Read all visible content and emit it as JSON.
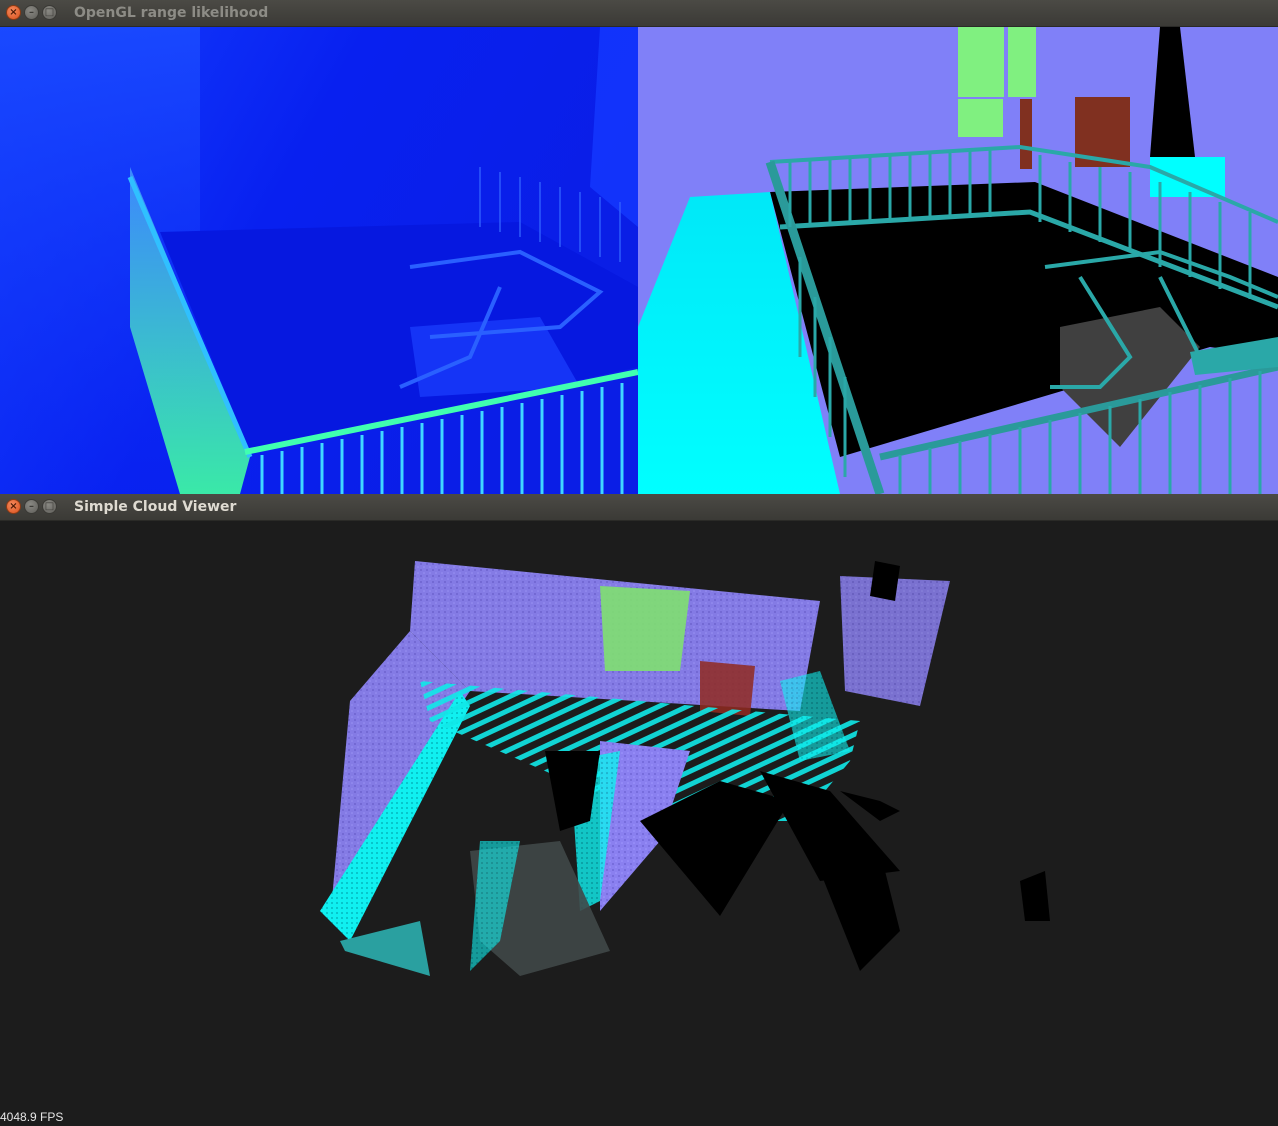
{
  "windows": {
    "top": {
      "title": "OpenGL range likelihood"
    },
    "bottom": {
      "title": "Simple Cloud Viewer"
    }
  },
  "window_buttons": {
    "close": "×",
    "minimize": "–",
    "maximize": "□"
  },
  "viewer": {
    "fps": "4048.9 FPS"
  },
  "icons": [
    "close-icon",
    "minimize-icon",
    "maximize-icon"
  ],
  "colors": {
    "titlebar": "#3c3b37",
    "close": "#e0592a",
    "viewer_bg": "#1c1c1c",
    "depth_blue": "#0b1ee8",
    "wall_lavender": "#8080f8",
    "rail_teal": "#2a9a9a",
    "cyan": "#00ffff",
    "window_green": "#80f080",
    "door_brown": "#803020"
  }
}
